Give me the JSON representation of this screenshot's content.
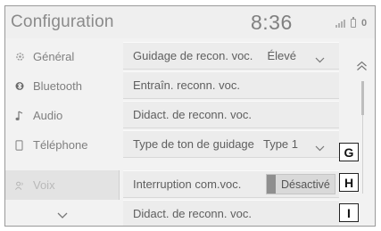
{
  "header": {
    "title": "Configuration",
    "time": "8:36",
    "notification_count": "0"
  },
  "sidebar": {
    "items": [
      {
        "label": "Général",
        "icon": "gear-icon"
      },
      {
        "label": "Bluetooth",
        "icon": "bluetooth-icon"
      },
      {
        "label": "Audio",
        "icon": "music-note-icon"
      },
      {
        "label": "Téléphone",
        "icon": "phone-icon"
      },
      {
        "label": "Voix",
        "icon": "voice-icon",
        "active": true
      }
    ],
    "more_icon": "chevron-down-icon"
  },
  "rows": [
    {
      "label": "Guidage de recon. voc.",
      "value": "Élevé"
    },
    {
      "label": "Entraîn. reconn. voc."
    },
    {
      "label": "Didact. de reconn. voc."
    },
    {
      "label": "Type de ton de guidage",
      "value": "Type 1",
      "callout": "G"
    },
    {
      "label": "Interruption com.voc.",
      "toggle": "Désactivé",
      "callout": "H"
    },
    {
      "label": "Didact. de reconn. voc.",
      "callout": "I"
    }
  ],
  "scroll": {
    "up_icon": "double-chevron-up-icon"
  }
}
